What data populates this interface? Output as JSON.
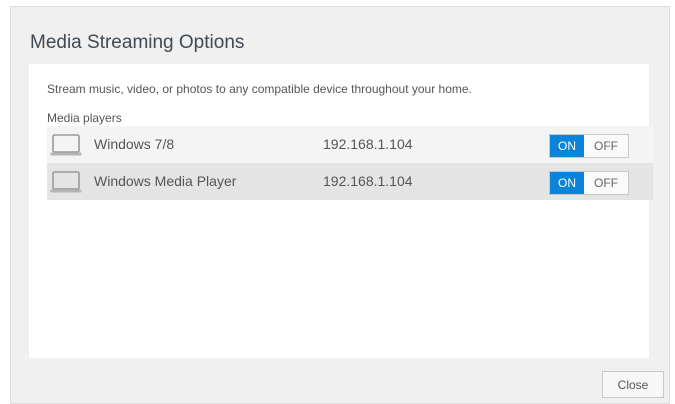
{
  "dialog": {
    "title": "Media Streaming Options",
    "description": "Stream music, video, or photos to any compatible device throughout your home.",
    "section_label": "Media players",
    "players": [
      {
        "icon": "laptop-icon",
        "name": "Windows 7/8",
        "ip": "192.168.1.104",
        "on_label": "ON",
        "off_label": "OFF",
        "state": "ON"
      },
      {
        "icon": "laptop-icon",
        "name": "Windows Media Player",
        "ip": "192.168.1.104",
        "on_label": "ON",
        "off_label": "OFF",
        "state": "ON"
      }
    ],
    "close_label": "Close"
  },
  "colors": {
    "accent": "#0a84d8",
    "dialog_background": "#f0f0f0",
    "panel_background": "#ffffff",
    "row_background": "#f4f4f4",
    "row_alt_background": "#e4e4e4"
  }
}
